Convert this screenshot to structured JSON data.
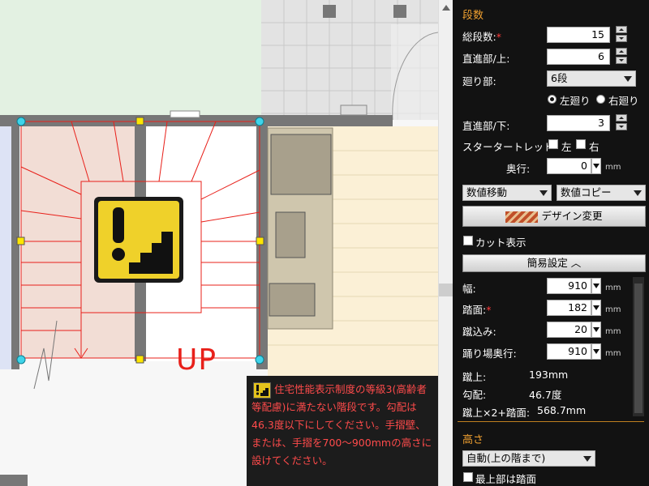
{
  "drawing": {
    "up_label": "UP",
    "warning_tooltip": "住宅性能表示制度の等級3(高齢者等配慮)に満たない階段です。勾配は46.3度以下にしてください。手摺壁、または、手摺を700～900mmの高さに設けてください。",
    "warning_color": "#ff4b4b",
    "stair_line_color": "#e8201a"
  },
  "panel": {
    "section_stairs": "段数",
    "total_steps_label": "総段数:",
    "total_steps_value": "15",
    "straight_upper_label": "直進部/上:",
    "straight_upper_value": "6",
    "winder_label": "廻り部:",
    "winder_value": "6段",
    "radio_left": "左廻り",
    "radio_right": "右廻り",
    "straight_lower_label": "直進部/下:",
    "straight_lower_value": "3",
    "starter_tread_label": "スタータートレッド",
    "starter_left": "左",
    "starter_right": "右",
    "depth_label": "奥行:",
    "depth_value": "0",
    "unit_mm": "mm",
    "numeric_move": "数値移動",
    "numeric_copy": "数値コピー",
    "design_change": "デザイン変更",
    "cut_display": "カット表示",
    "simple_settings": "簡易設定",
    "width_label": "幅:",
    "width_value": "910",
    "tread_label": "踏面:",
    "tread_value": "182",
    "nosing_label": "蹴込み:",
    "nosing_value": "20",
    "landing_depth_label": "踊り場奥行:",
    "landing_depth_value": "910",
    "riser_label": "蹴上:",
    "riser_value": "193mm",
    "slope_label": "勾配:",
    "slope_value": "46.7度",
    "formula_label": "蹴上×2+踏面:",
    "formula_value": "568.7mm",
    "section_height": "高さ",
    "height_mode": "自動(上の階まで)",
    "top_tread_label": "最上部は踏面",
    "accent_color": "#f0a030"
  }
}
